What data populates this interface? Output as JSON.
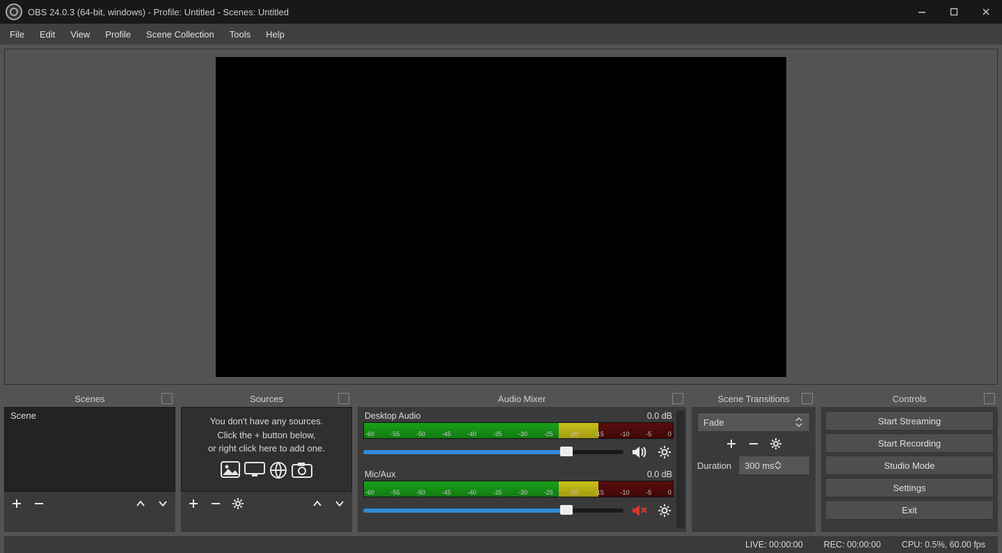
{
  "titlebar": {
    "text": "OBS 24.0.3 (64-bit, windows) - Profile: Untitled - Scenes: Untitled"
  },
  "menu": {
    "items": [
      "File",
      "Edit",
      "View",
      "Profile",
      "Scene Collection",
      "Tools",
      "Help"
    ]
  },
  "docks": {
    "scenes": {
      "title": "Scenes"
    },
    "sources": {
      "title": "Sources"
    },
    "mixer": {
      "title": "Audio Mixer"
    },
    "transitions": {
      "title": "Scene Transitions"
    },
    "controls": {
      "title": "Controls"
    }
  },
  "scenes": {
    "items": [
      "Scene"
    ]
  },
  "sources": {
    "empty_lines": [
      "You don't have any sources.",
      "Click the + button below,",
      "or right click here to add one."
    ]
  },
  "mixer": {
    "ticks": [
      "-60",
      "-55",
      "-50",
      "-45",
      "-40",
      "-35",
      "-30",
      "-25",
      "-20",
      "-15",
      "-10",
      "-5",
      "0"
    ],
    "tracks": [
      {
        "name": "Desktop Audio",
        "level": "0.0 dB",
        "muted": false
      },
      {
        "name": "Mic/Aux",
        "level": "0.0 dB",
        "muted": true
      }
    ]
  },
  "transitions": {
    "selected": "Fade",
    "duration_label": "Duration",
    "duration_value": "300 ms"
  },
  "controls": {
    "buttons": [
      "Start Streaming",
      "Start Recording",
      "Studio Mode",
      "Settings",
      "Exit"
    ]
  },
  "status": {
    "live": "LIVE: 00:00:00",
    "rec": "REC: 00:00:00",
    "cpu": "CPU: 0.5%, 60.00 fps"
  }
}
